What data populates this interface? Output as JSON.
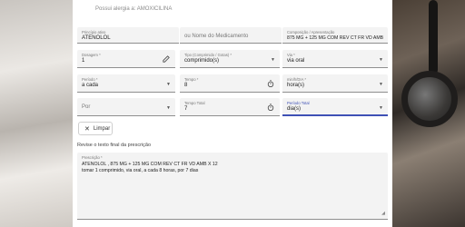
{
  "allergy_notice": "Possui alergia a: AMOXICILINA",
  "principle": {
    "label": "Princípio ativo",
    "value": "ATENOLOL"
  },
  "medicine_name": {
    "placeholder": "ou Nome do Medicamento"
  },
  "composition": {
    "label": "Composição / Apresentação",
    "value": "875 MG + 125 MG COM REV CT FR VD AMB"
  },
  "dosage": {
    "label": "Dosagem *",
    "value": "1"
  },
  "type": {
    "label": "Tipo (Comprimido / Gotas) *",
    "value": "comprimido(s)"
  },
  "route": {
    "label": "Via *",
    "value": "via oral"
  },
  "period": {
    "label": "Período *",
    "value": "a cada"
  },
  "time": {
    "label": "Tempo *",
    "value": "8"
  },
  "time_unit": {
    "label": "min/h/DIA *",
    "value": "hora(s)"
  },
  "for": {
    "placeholder": "Por"
  },
  "total_time": {
    "label": "Tempo Total",
    "value": "7"
  },
  "total_period": {
    "label": "Período Total",
    "value": "dia(s)"
  },
  "clear_button": {
    "label": "Limpar"
  },
  "review_heading": "Revise o texto final da prescrição",
  "prescription": {
    "label": "Prescrição *",
    "line1": "ATENOLOL , 875 MG + 125 MG COM REV CT FR VD AMB X 12",
    "line2": "tomar 1 comprimido, via oral, a cada 8 horas, por 7 dias"
  },
  "colors": {
    "accent": "#3f51b5",
    "field_bg": "#f3f3f3"
  },
  "icons": {
    "dosage_edit": "pencil-icon",
    "time": "stopwatch-icon",
    "total_time": "stopwatch-icon",
    "dropdown": "caret-down-icon",
    "clear": "close-icon"
  }
}
